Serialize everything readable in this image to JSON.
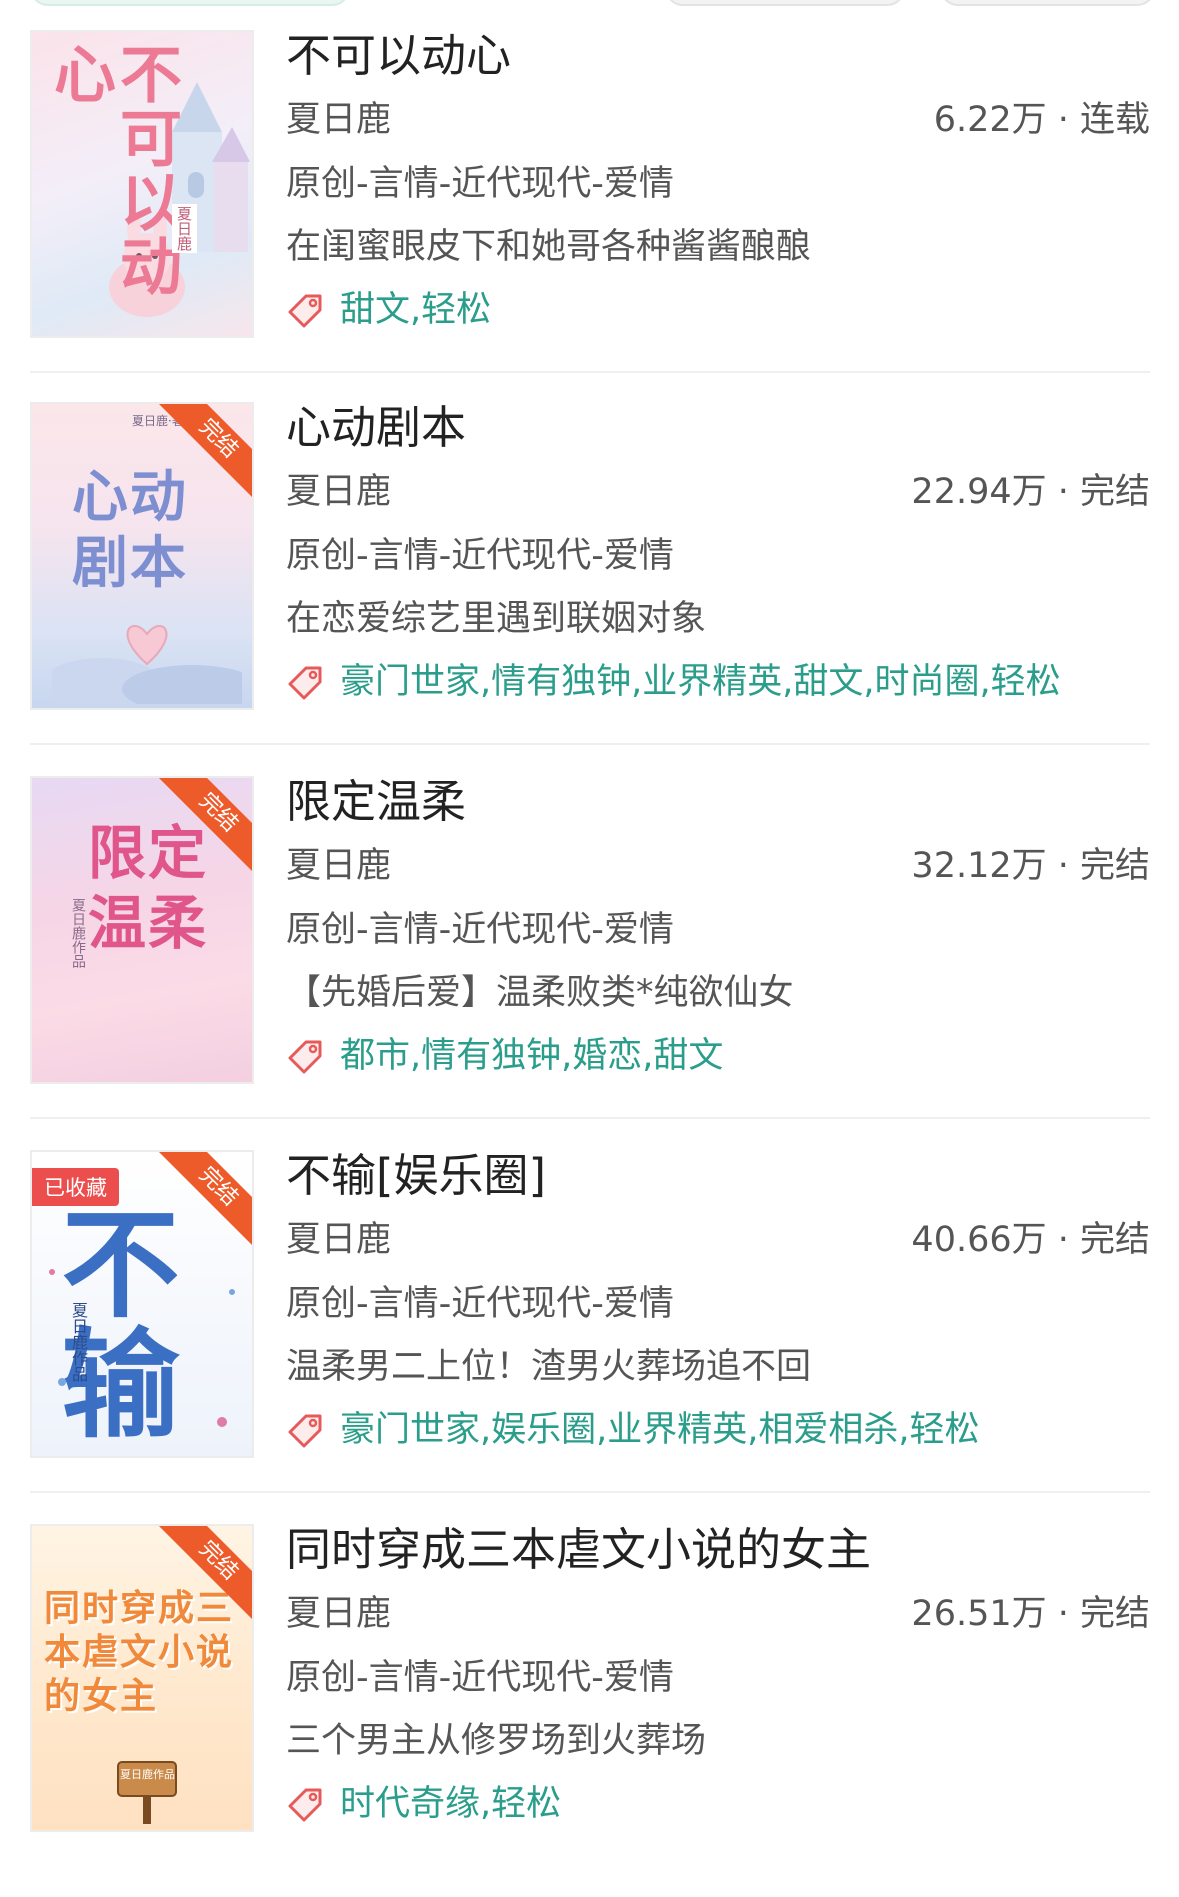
{
  "books": [
    {
      "title": "不可以动心",
      "author": "夏日鹿",
      "stats": "6.22万 · 连载",
      "category": "原创-言情-近代现代-爱情",
      "summary": "在闺蜜眼皮下和她哥各种酱酱酿酿",
      "tags": "甜文,轻松",
      "cover": {
        "title_text": "不可以动心",
        "author_text": "夏日鹿"
      }
    },
    {
      "title": "心动剧本",
      "author": "夏日鹿",
      "stats": "22.94万 · 完结",
      "category": "原创-言情-近代现代-爱情",
      "summary": "在恋爱综艺里遇到联姻对象",
      "tags": "豪门世家,情有独钟,业界精英,甜文,时尚圈,轻松",
      "cover": {
        "title_text": "心动剧本",
        "author_text": "夏日鹿·著",
        "ribbon": "完结"
      }
    },
    {
      "title": "限定温柔",
      "author": "夏日鹿",
      "stats": "32.12万 · 完结",
      "category": "原创-言情-近代现代-爱情",
      "summary": "【先婚后爱】温柔败类*纯欲仙女",
      "tags": "都市,情有独钟,婚恋,甜文",
      "cover": {
        "title_text": "限定温柔",
        "author_text": "夏日鹿作品",
        "ribbon": "完结"
      }
    },
    {
      "title": "不输[娱乐圈]",
      "author": "夏日鹿",
      "stats": "40.66万 · 完结",
      "category": "原创-言情-近代现代-爱情",
      "summary": "温柔男二上位！渣男火葬场追不回",
      "tags": "豪门世家,娱乐圈,业界精英,相爱相杀,轻松",
      "cover": {
        "title_text": "不输",
        "author_text": "夏日鹿作品",
        "ribbon": "完结",
        "badge": "已收藏"
      }
    },
    {
      "title": "同时穿成三本虐文小说的女主",
      "author": "夏日鹿",
      "stats": "26.51万 · 完结",
      "category": "原创-言情-近代现代-爱情",
      "summary": "三个男主从修罗场到火葬场",
      "tags": "时代奇缘,轻松",
      "cover": {
        "title_text": "同时穿成三本虐文小说的女主",
        "author_text": "夏日鹿作品",
        "ribbon": "完结"
      }
    }
  ],
  "colors": {
    "tag_text": "#2a9d8b",
    "ribbon": "#ee5b2b",
    "badge": "#ec4d4d",
    "tag_icon": "#e65a5a"
  },
  "icons": {
    "tag": "tag-icon"
  }
}
